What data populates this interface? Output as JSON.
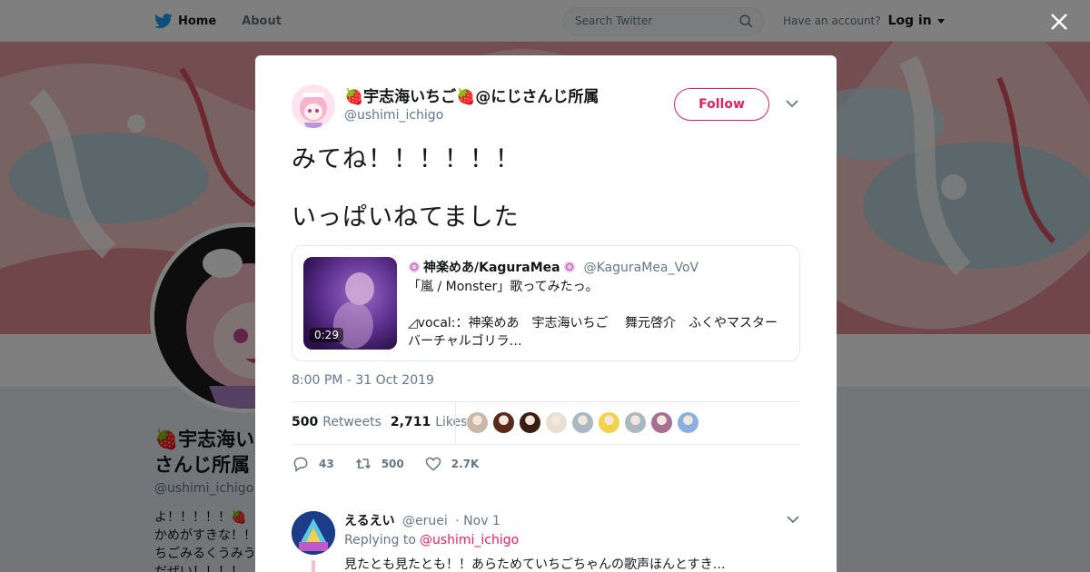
{
  "topbar": {
    "home_label": "Home",
    "about_label": "About",
    "search_placeholder": "Search Twitter",
    "have_account": "Have an account?",
    "login_label": "Log in"
  },
  "profile": {
    "name_line1": "🍓宇志海い",
    "name_line2": "さんじ所属",
    "handle": "@ushimi_ichigo",
    "bio_lines": [
      "よ！！！！！🍓",
      "かめがすきな！！",
      "ちごみるくうみう",
      "だぜい！！！！"
    ]
  },
  "tweet": {
    "author_name": "🍓宇志海いちご🍓@にじさんじ所属",
    "author_handle": "@ushimi_ichigo",
    "follow_label": "Follow",
    "text_line1": "みてね！！！！！！",
    "text_line2": "いっぱいねてました",
    "timestamp": "8:00 PM - 31 Oct 2019",
    "retweets_count": "500",
    "retweets_label": "Retweets",
    "likes_count": "2,711",
    "likes_label": "Likes",
    "reply_count": "43",
    "retweet_action_count": "500",
    "like_action_count": "2.7K",
    "liker_colors": [
      "#c9b8a8",
      "#5a2a1a",
      "#3a1e14",
      "#e8e0d0",
      "#aab8c2",
      "#f2d24a",
      "#aab8c2",
      "#a87090",
      "#8ab0e0"
    ]
  },
  "quoted": {
    "name": "神楽めあ/KaguraMea",
    "handle": "@KaguraMea_VoV",
    "line1": "「嵐 / Monster」歌ってみたっ。",
    "line2": "◿vocal:：神楽めあ　宇志海いちご　 舞元啓介　ふくやマスター",
    "line3": "バーチャルゴリラ…",
    "duration": "0:29"
  },
  "reply": {
    "name": "えるえい",
    "handle": "@eruei",
    "date": "· Nov 1",
    "replying_label": "Replying to",
    "replying_to": "@ushimi_ichigo",
    "text": "見たとも見たとも！！あらためていちごちゃんの歌声ほんとすき…"
  },
  "colors": {
    "accent": "#e0245e",
    "twitter_blue": "#1da1f2",
    "muted": "#657786"
  }
}
